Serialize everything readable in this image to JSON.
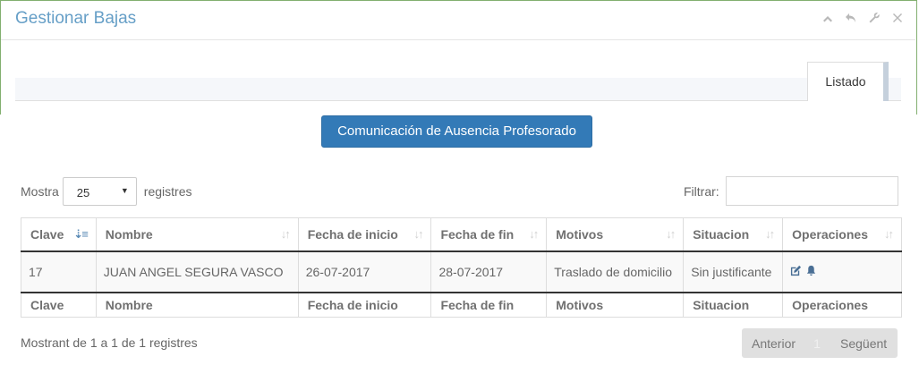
{
  "window": {
    "title": "Gestionar Bajas"
  },
  "toolbar": {
    "icons": [
      "chevron-up-icon",
      "undo-icon",
      "wrench-icon",
      "close-icon"
    ]
  },
  "tabs": [
    {
      "label": "Listado",
      "active": true
    }
  ],
  "actions": {
    "communication_button": "Comunicación de Ausencia Profesorado"
  },
  "length": {
    "prefix": "Mostra",
    "value": "25",
    "suffix": "registres"
  },
  "filter": {
    "label": "Filtrar:",
    "value": "",
    "placeholder": ""
  },
  "table": {
    "columns": [
      "Clave",
      "Nombre",
      "Fecha de inicio",
      "Fecha de fin",
      "Motivos",
      "Situacion",
      "Operaciones"
    ],
    "rows": [
      {
        "clave": "17",
        "nombre": "JUAN ANGEL SEGURA VASCO",
        "fecha_inicio": "26-07-2017",
        "fecha_fin": "28-07-2017",
        "motivos": "Traslado de domicilio",
        "situacion": "Sin justificante",
        "operaciones": [
          "edit-icon",
          "bell-icon"
        ]
      }
    ],
    "footer": [
      "Clave",
      "Nombre",
      "Fecha de inicio",
      "Fecha de fin",
      "Motivos",
      "Situacion",
      "Operaciones"
    ]
  },
  "info": "Mostrant de 1 a 1 de 1 registres",
  "pagination": {
    "previous": "Anterior",
    "page": "1",
    "next": "Següent"
  },
  "colors": {
    "accent": "#337ab7",
    "title": "#669fc7",
    "frame": "#82af6f"
  }
}
